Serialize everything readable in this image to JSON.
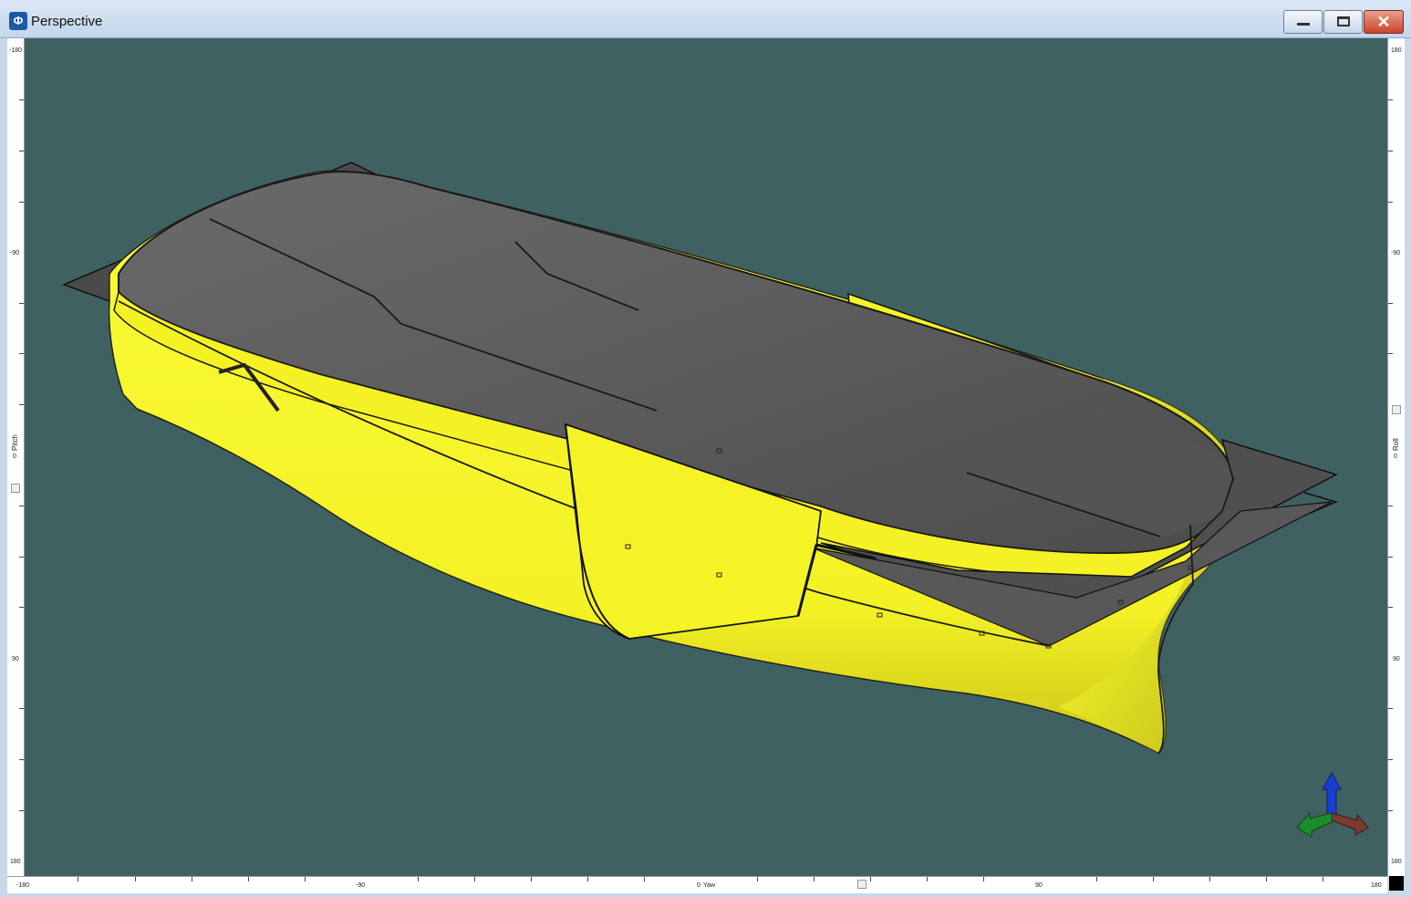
{
  "window": {
    "title": "Perspective",
    "icon": "app-icon",
    "controls": [
      "minimize-icon",
      "maximize-icon",
      "close-icon"
    ],
    "close_glyph": "✕"
  },
  "app_icon_glyph": "Φ",
  "rulers": {
    "left": {
      "ticks": [
        "-180",
        "-90",
        "0",
        "90",
        "180"
      ],
      "label": "Pitch"
    },
    "right": {
      "ticks": [
        "180",
        "-90",
        "0",
        "90",
        "180"
      ],
      "label": "Roll"
    },
    "bottom": {
      "ticks": [
        "-180",
        "-90",
        "0",
        "90",
        "180"
      ],
      "label": "Yaw"
    }
  },
  "viewport": {
    "background": "#406161",
    "model_colors": {
      "hull": "#f4f224",
      "deck": "#5e5e5e",
      "plane": "#4a4a4a",
      "edge": "#1a1a1a"
    }
  },
  "axis_gizmo": {
    "x": "red-axis",
    "y": "green-axis",
    "z": "blue-axis"
  }
}
